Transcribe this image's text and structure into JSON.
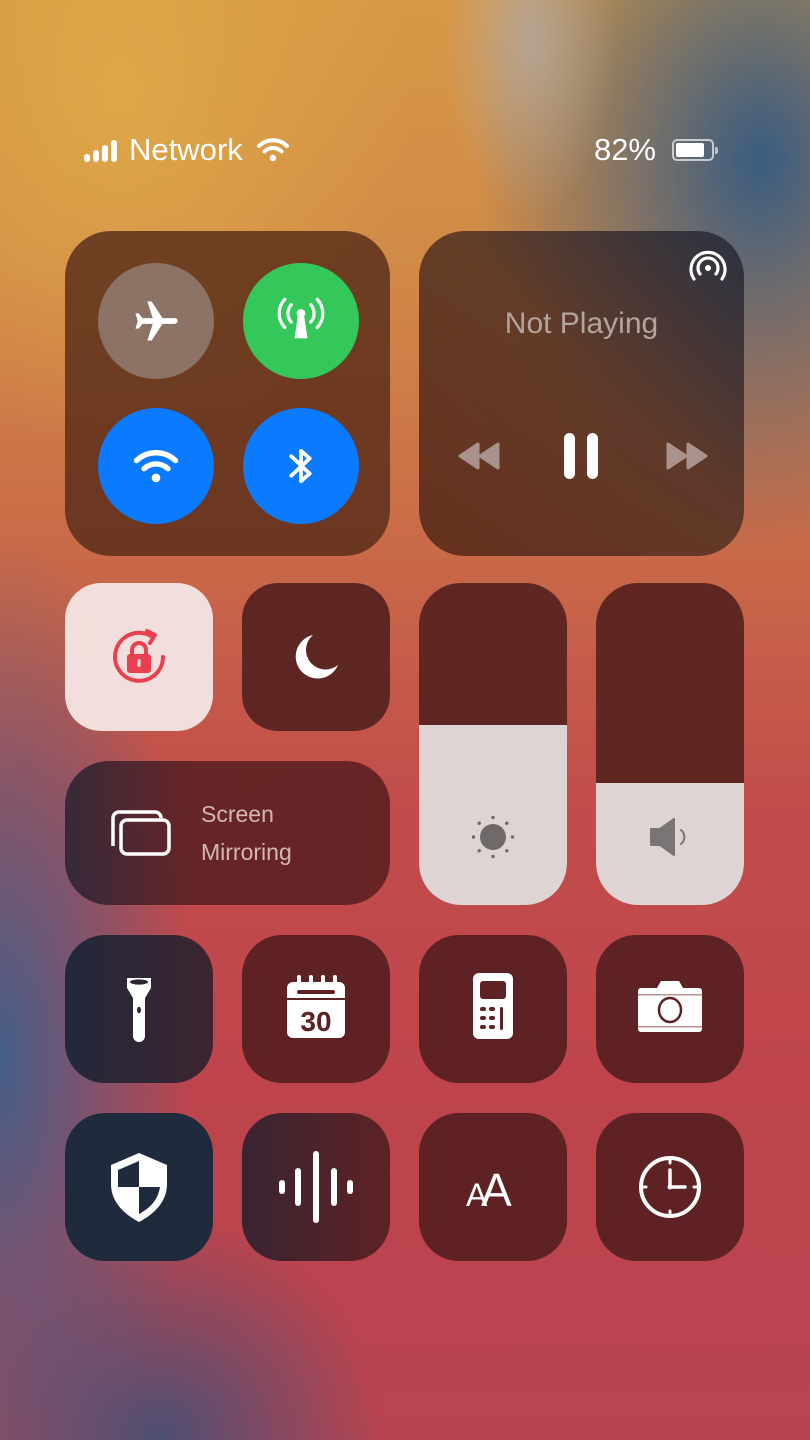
{
  "status_bar": {
    "carrier": "Network",
    "battery_text": "82%",
    "battery_level": 0.82,
    "signal_bars": 4
  },
  "connectivity": {
    "airplane": {
      "label": "Airplane Mode",
      "on": false,
      "color": "#8c7366"
    },
    "cellular": {
      "label": "Cellular Data",
      "on": true,
      "color": "#34c759"
    },
    "wifi": {
      "label": "Wi-Fi",
      "on": true,
      "color": "#0a7aff"
    },
    "bluetooth": {
      "label": "Bluetooth",
      "on": true,
      "color": "#0a7aff"
    }
  },
  "media": {
    "title": "Not Playing",
    "icons": [
      "airplay-icon",
      "rewind-icon",
      "pause-icon",
      "fast-forward-icon"
    ]
  },
  "toggles": {
    "rotation_lock": {
      "label": "Orientation Lock",
      "on": true,
      "accent": "#e8404f"
    },
    "do_not_disturb": {
      "label": "Do Not Disturb",
      "on": false
    }
  },
  "screen_mirroring": {
    "line1": "Screen",
    "line2": "Mirroring"
  },
  "sliders": {
    "brightness": {
      "label": "Brightness",
      "value": 0.56
    },
    "volume": {
      "label": "Volume",
      "value": 0.38
    }
  },
  "shortcuts": [
    {
      "name": "flashlight",
      "icon": "flashlight-icon"
    },
    {
      "name": "calendar",
      "icon": "calendar-icon",
      "text": "30"
    },
    {
      "name": "calculator",
      "icon": "calculator-icon"
    },
    {
      "name": "camera",
      "icon": "camera-icon"
    },
    {
      "name": "security",
      "icon": "shield-icon"
    },
    {
      "name": "voice-memos",
      "icon": "waveform-icon"
    },
    {
      "name": "text-size",
      "icon": "text-size-icon",
      "text": "AA"
    },
    {
      "name": "clock",
      "icon": "clock-icon"
    }
  ]
}
